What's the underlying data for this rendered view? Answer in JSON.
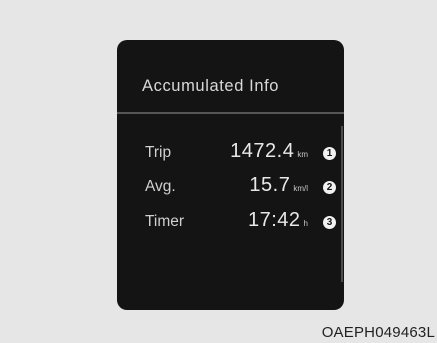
{
  "display": {
    "title": "Accumulated Info",
    "rows": [
      {
        "label": "Trip",
        "value": "1472.4",
        "unit": "km",
        "marker": "1"
      },
      {
        "label": "Avg.",
        "value": "15.7",
        "unit": "km/l",
        "marker": "2"
      },
      {
        "label": "Timer",
        "value": "17:42",
        "unit": "h",
        "marker": "3"
      }
    ]
  },
  "caption": "OAEPH049463L",
  "colors": {
    "background": "#e6e6e6",
    "screen": "#141414",
    "text": "#e8e8e8"
  }
}
